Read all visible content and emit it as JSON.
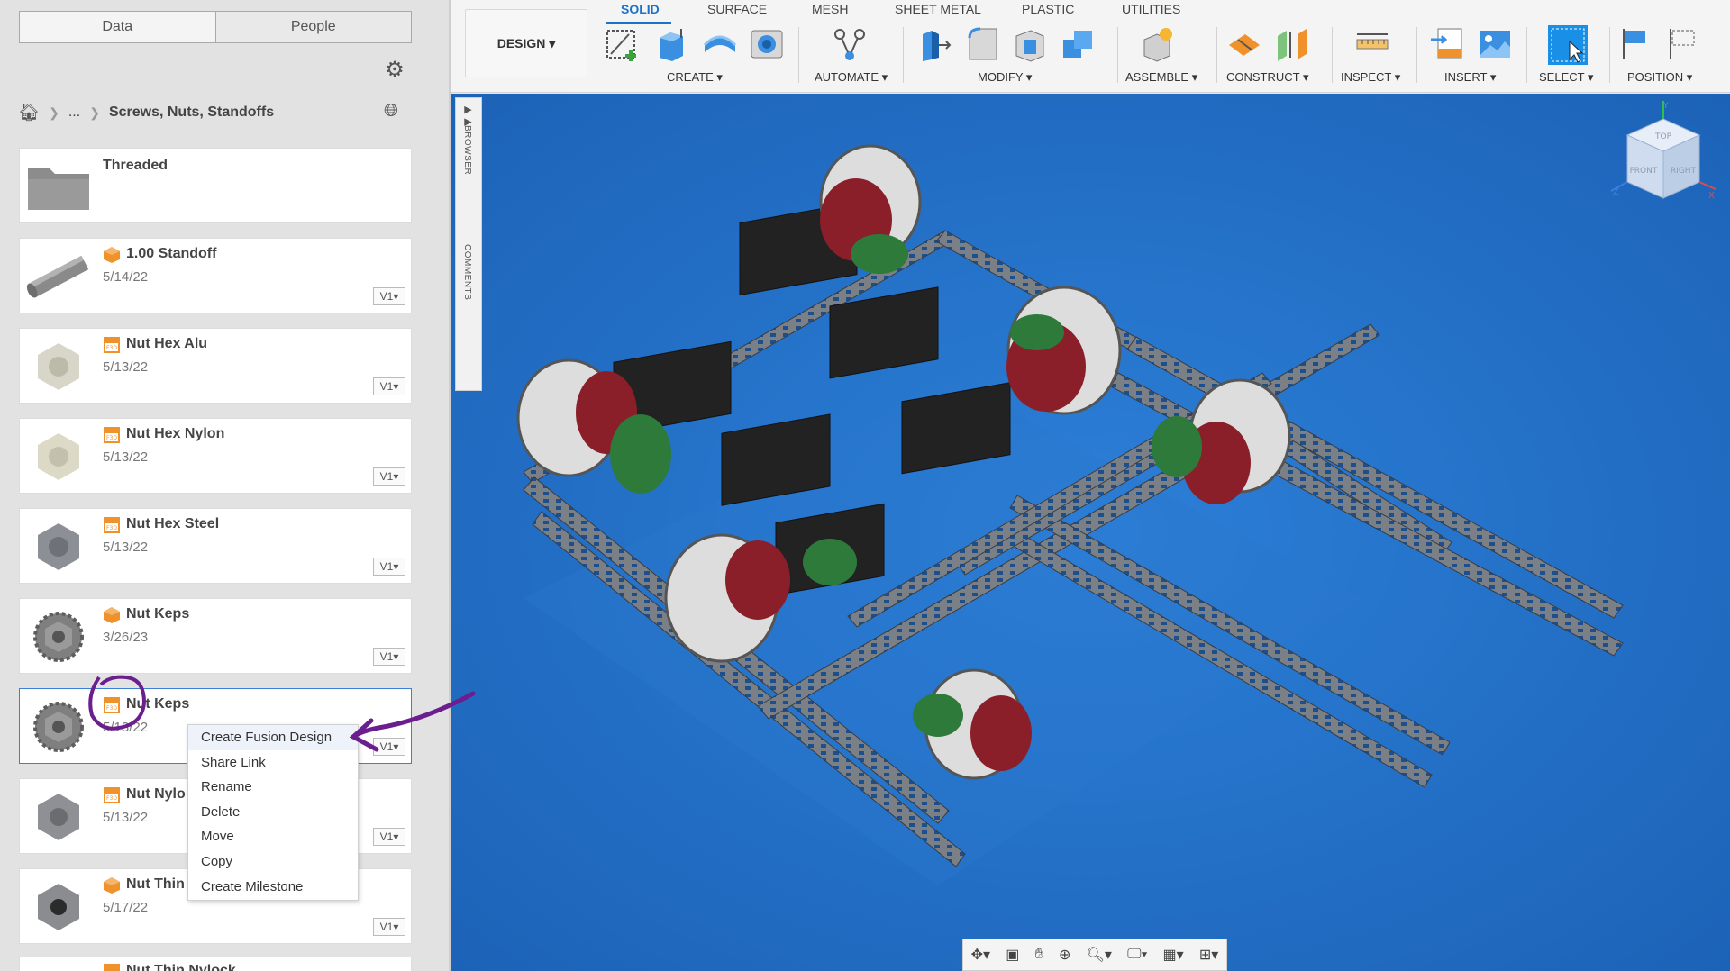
{
  "left_panel": {
    "tabs": [
      "Data",
      "People"
    ],
    "breadcrumb": {
      "ellipsis": "...",
      "current": "Screws, Nuts, Standoffs"
    },
    "files": [
      {
        "title": "Threaded",
        "kind": "folder"
      },
      {
        "title": "1.00 Standoff",
        "date": "5/14/22",
        "version": "V1",
        "kind": "design"
      },
      {
        "title": "Nut Hex Alu",
        "date": "5/13/22",
        "version": "V1",
        "kind": "f3d"
      },
      {
        "title": "Nut Hex Nylon",
        "date": "5/13/22",
        "version": "V1",
        "kind": "f3d"
      },
      {
        "title": "Nut Hex Steel",
        "date": "5/13/22",
        "version": "V1",
        "kind": "f3d"
      },
      {
        "title": "Nut Keps",
        "date": "3/26/23",
        "version": "V1",
        "kind": "design"
      },
      {
        "title": "Nut Keps",
        "date": "5/13/22",
        "version": "V1",
        "kind": "f3d",
        "selected": true
      },
      {
        "title": "Nut Nylo",
        "date": "5/13/22",
        "version": "V1",
        "kind": "f3d"
      },
      {
        "title": "Nut Thin",
        "date": "5/17/22",
        "version": "V1",
        "kind": "design"
      },
      {
        "title": "Nut Thin Nylock",
        "date": "",
        "version": "",
        "kind": "f3d"
      }
    ]
  },
  "context_menu": {
    "items": [
      "Create Fusion Design",
      "Share Link",
      "Rename",
      "Delete",
      "Move",
      "Copy",
      "Create Milestone"
    ]
  },
  "toolbar": {
    "workspace": "DESIGN ▾",
    "tabs": [
      "SOLID",
      "SURFACE",
      "MESH",
      "SHEET METAL",
      "PLASTIC",
      "UTILITIES"
    ],
    "groups": [
      "CREATE ▾",
      "AUTOMATE ▾",
      "MODIFY ▾",
      "ASSEMBLE ▾",
      "CONSTRUCT ▾",
      "INSPECT ▾",
      "INSERT ▾",
      "SELECT ▾",
      "POSITION ▾"
    ]
  },
  "canvas": {
    "browser_label": "BROWSER",
    "comments_label": "COMMENTS",
    "viewcube": {
      "top": "TOP",
      "front": "FRONT",
      "right": "RIGHT",
      "x": "X",
      "y": "Y",
      "z": "Z"
    }
  },
  "colors": {
    "canvas_bg": "#1f6cc4",
    "accent": "#1a73c8",
    "annotation": "#6b1f8f",
    "f3d_badge": "#f0922b"
  }
}
